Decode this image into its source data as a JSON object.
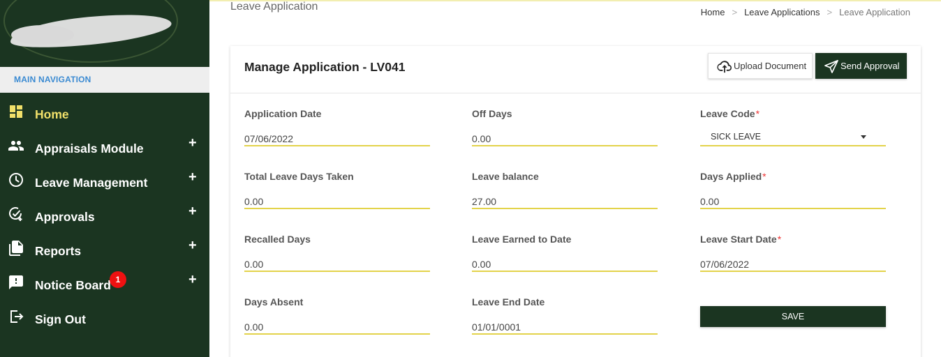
{
  "sidebar": {
    "nav_header": "MAIN NAVIGATION",
    "items": [
      {
        "label": "Home",
        "icon": "dashboard-icon",
        "active": true
      },
      {
        "label": "Appraisals Module",
        "icon": "people-icon",
        "expand": "+"
      },
      {
        "label": "Leave Management",
        "icon": "clock-icon",
        "expand": "+"
      },
      {
        "label": "Approvals",
        "icon": "check-circle-icon",
        "expand": "+"
      },
      {
        "label": "Reports",
        "icon": "documents-icon",
        "expand": "+"
      },
      {
        "label": "Notice Board",
        "icon": "feedback-icon",
        "expand": "+",
        "badge": "1"
      },
      {
        "label": "Sign Out",
        "icon": "exit-icon"
      }
    ]
  },
  "header": {
    "page_title": "Leave Application",
    "breadcrumb": [
      "Home",
      "Leave Applications",
      "Leave Application"
    ],
    "breadcrumb_sep": ">"
  },
  "card": {
    "title": "Manage Application - LV041",
    "upload_label": "Upload Document",
    "send_label": "Send Approval",
    "save_label": "SAVE"
  },
  "form": {
    "application_date": {
      "label": "Application Date",
      "value": "07/06/2022"
    },
    "off_days": {
      "label": "Off Days",
      "value": "0.00"
    },
    "leave_code": {
      "label": "Leave Code",
      "value": "SICK LEAVE",
      "required": "*"
    },
    "total_leave_days_taken": {
      "label": "Total Leave Days Taken",
      "value": "0.00"
    },
    "leave_balance": {
      "label": "Leave balance",
      "value": "27.00"
    },
    "days_applied": {
      "label": "Days Applied",
      "value": "0.00",
      "required": "*"
    },
    "recalled_days": {
      "label": "Recalled Days",
      "value": "0.00"
    },
    "leave_earned_to_date": {
      "label": "Leave Earned to Date",
      "value": "0.00"
    },
    "leave_start_date": {
      "label": "Leave Start Date",
      "value": "07/06/2022",
      "required": "*"
    },
    "days_absent": {
      "label": "Days Absent",
      "value": "0.00"
    },
    "leave_end_date": {
      "label": "Leave End Date",
      "value": "01/01/0001"
    }
  },
  "colors": {
    "sidebar_bg": "#1b3521",
    "active_nav": "#f1e06a",
    "nav_header_text": "#3a8ad2",
    "input_underline": "#e3d34a",
    "badge": "#ee1111",
    "required": "#e33333"
  }
}
